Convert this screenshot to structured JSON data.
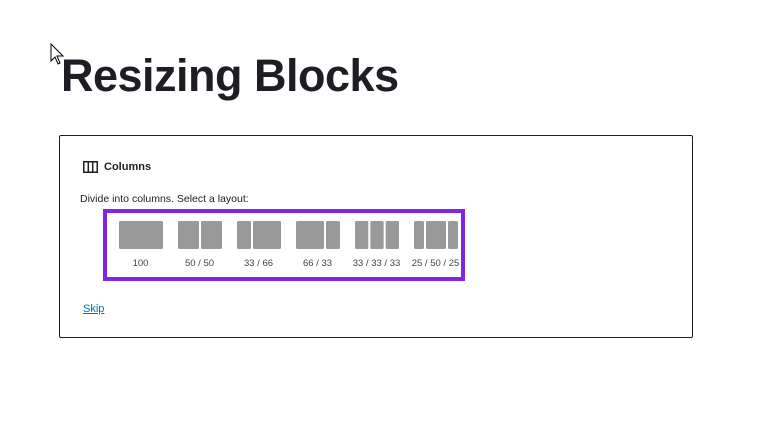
{
  "page": {
    "title": "Resizing Blocks"
  },
  "block": {
    "label": "Columns",
    "instructions": "Divide into columns. Select a layout:",
    "variations": [
      {
        "label": "100",
        "widths": [
          100
        ]
      },
      {
        "label": "50 / 50",
        "widths": [
          50,
          50
        ]
      },
      {
        "label": "33 / 66",
        "widths": [
          33,
          66
        ]
      },
      {
        "label": "66 / 33",
        "widths": [
          66,
          33
        ]
      },
      {
        "label": "33 / 33 / 33",
        "widths": [
          33,
          33,
          33
        ]
      },
      {
        "label": "25 / 50 / 25",
        "widths": [
          25,
          50,
          25
        ]
      }
    ],
    "skip_label": "Skip"
  },
  "colors": {
    "highlight": "#8224e3",
    "link": "#0073aa",
    "column_fill": "#999999"
  },
  "icons": {
    "block_icon": "columns-icon",
    "cursor": "mouse-pointer-icon"
  }
}
